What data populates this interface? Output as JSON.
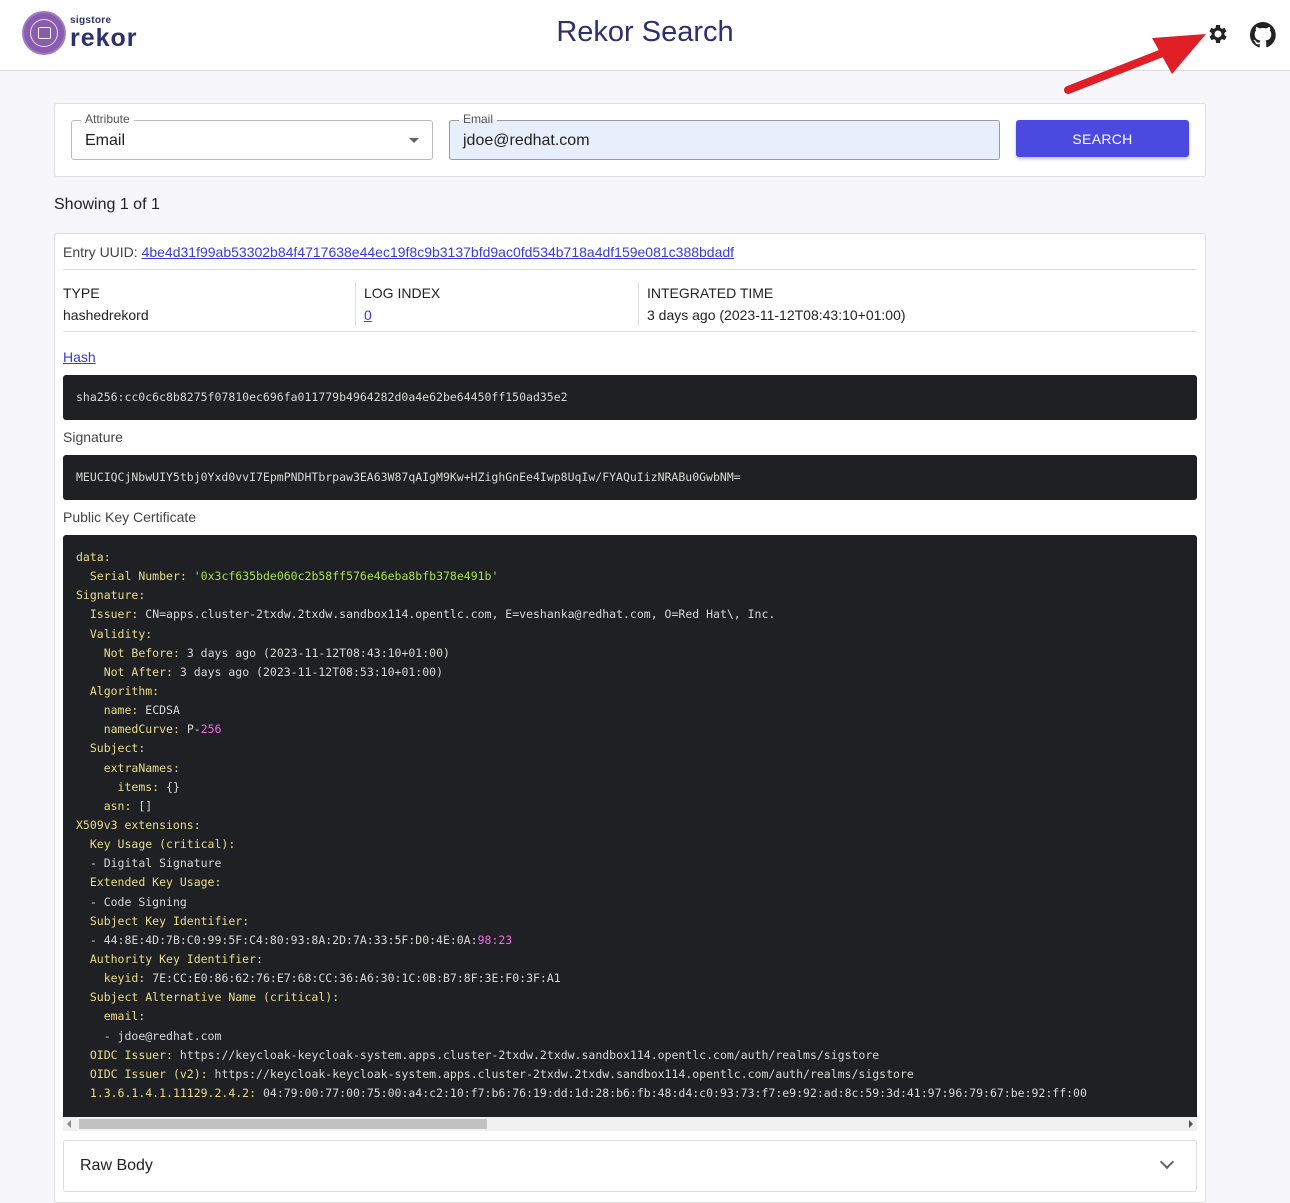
{
  "header": {
    "logo_small": "sigstore",
    "logo_big": "rekor",
    "title": "Rekor Search"
  },
  "search": {
    "attribute_label": "Attribute",
    "attribute_value": "Email",
    "email_label": "Email",
    "email_value": "jdoe@redhat.com",
    "search_button": "SEARCH"
  },
  "results": {
    "showing": "Showing 1 of 1"
  },
  "entry": {
    "uuid_label": "Entry UUID:",
    "uuid": "4be4d31f99ab53302b84f4717638e44ec19f8c9b3137bfd9ac0fd534b718a4df159e081c388bdadf",
    "type_label": "TYPE",
    "type": "hashedrekord",
    "log_index_label": "LOG INDEX",
    "log_index": "0",
    "integrated_time_label": "INTEGRATED TIME",
    "integrated_time": "3 days ago (2023-11-12T08:43:10+01:00)",
    "hash_label": "Hash",
    "hash": "sha256:cc0c6c8b8275f07810ec696fa011779b4964282d0a4e62be64450ff150ad35e2",
    "signature_label": "Signature",
    "signature": "MEUCIQCjNbwUIY5tbj0Yxd0vvI7EpmPNDHTbrpaw3EA63W87qAIgM9Kw+HZighGnEe4Iwp8UqIw/FYAQuIizNRABu0GwbNM=",
    "cert_label": "Public Key Certificate",
    "cert_lines": [
      {
        "i": 0,
        "k": "data",
        "v": ""
      },
      {
        "i": 1,
        "k": "Serial Number",
        "v": "'0x3cf635bde060c2b58ff576e46eba8bfb378e491b'",
        "c": "s"
      },
      {
        "i": 0,
        "k": "Signature",
        "v": ""
      },
      {
        "i": 1,
        "k": "Issuer",
        "v": "CN=apps.cluster-2txdw.2txdw.sandbox114.opentlc.com, E=veshanka@redhat.com, O=Red Hat\\, Inc."
      },
      {
        "i": 1,
        "k": "Validity",
        "v": ""
      },
      {
        "i": 2,
        "k": "Not Before",
        "v": "3 days ago (2023-11-12T08:43:10+01:00)"
      },
      {
        "i": 2,
        "k": "Not After",
        "v": "3 days ago (2023-11-12T08:53:10+01:00)"
      },
      {
        "i": 1,
        "k": "Algorithm",
        "v": ""
      },
      {
        "i": 2,
        "k": "name",
        "v": "ECDSA"
      },
      {
        "i": 2,
        "k": "namedCurve",
        "v": "P-",
        "n": "256"
      },
      {
        "i": 1,
        "k": "Subject",
        "v": ""
      },
      {
        "i": 2,
        "k": "extraNames",
        "v": ""
      },
      {
        "i": 3,
        "k": "items",
        "v": "{}"
      },
      {
        "i": 2,
        "k": "asn",
        "v": "[]"
      },
      {
        "i": 0,
        "k": "X509v3 extensions",
        "v": ""
      },
      {
        "i": 1,
        "k": "Key Usage (critical)",
        "v": ""
      },
      {
        "i": 1,
        "t": "- Digital Signature"
      },
      {
        "i": 1,
        "k": "Extended Key Usage",
        "v": ""
      },
      {
        "i": 1,
        "t": "- Code Signing"
      },
      {
        "i": 1,
        "k": "Subject Key Identifier",
        "v": ""
      },
      {
        "i": 1,
        "t": "- 44:8E:4D:7B:C0:99:5F:C4:80:93:8A:2D:7A:33:5F:D0:4E:0A:",
        "n": "98:23"
      },
      {
        "i": 1,
        "k": "Authority Key Identifier",
        "v": ""
      },
      {
        "i": 2,
        "k": "keyid",
        "v": "7E:CC:E0:86:62:76:E7:68:CC:36:A6:30:1C:0B:B7:8F:3E:F0:3F:A1"
      },
      {
        "i": 1,
        "k": "Subject Alternative Name (critical)",
        "v": ""
      },
      {
        "i": 2,
        "k": "email",
        "v": ""
      },
      {
        "i": 2,
        "t": "- jdoe@redhat.com"
      },
      {
        "i": 1,
        "k": "OIDC Issuer",
        "v": "https://keycloak-keycloak-system.apps.cluster-2txdw.2txdw.sandbox114.opentlc.com/auth/realms/sigstore"
      },
      {
        "i": 1,
        "k": "OIDC Issuer (v2)",
        "v": "https://keycloak-keycloak-system.apps.cluster-2txdw.2txdw.sandbox114.opentlc.com/auth/realms/sigstore"
      },
      {
        "i": 1,
        "k": "1.3.6.1.4.1.11129.2.4.2",
        "v": "04:79:00:77:00:75:00:a4:c2:10:f7:b6:76:19:dd:1d:28:b6:fb:48:d4:c0:93:73:f7:e9:92:ad:8c:59:3d:41:97:96:79:67:be:92:ff:00"
      }
    ],
    "raw_body_label": "Raw Body"
  },
  "colors": {
    "accent": "#4a4ae0",
    "brand": "#2e2f6e",
    "annotation_arrow": "#e01e26"
  }
}
